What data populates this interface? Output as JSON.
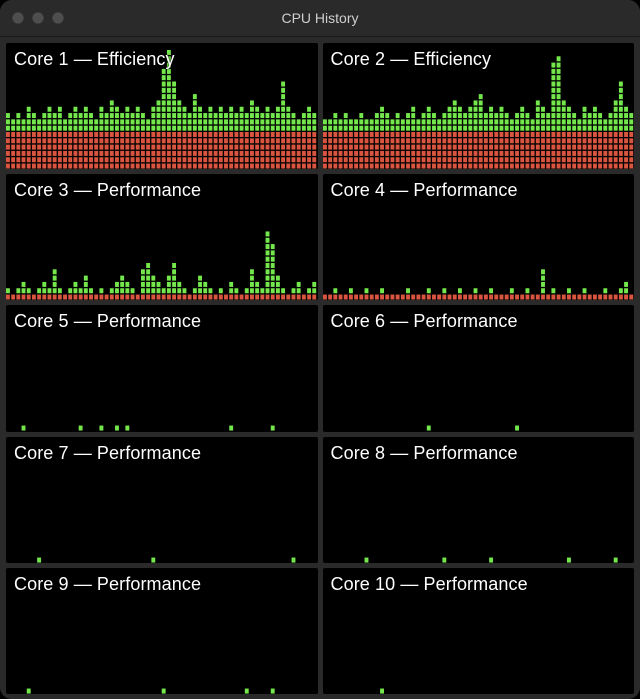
{
  "window": {
    "title": "CPU History"
  },
  "colors": {
    "user": "#74e74c",
    "system": "#d95540",
    "gap": "#000000",
    "panel_bg": "#000000",
    "chrome_bg": "#2a2a2a"
  },
  "layout": {
    "columns_per_panel": 60,
    "max_rows_per_panel": 20,
    "bar_width": 3.6,
    "bar_gap": 1.2,
    "seg_height": 3.8,
    "seg_gap": 1.0
  },
  "cores": [
    {
      "id": 1,
      "label": "Core 1 — Efficiency",
      "system_usage": [
        6,
        6,
        6,
        6,
        6,
        6,
        6,
        6,
        6,
        6,
        6,
        6,
        6,
        6,
        6,
        6,
        6,
        6,
        6,
        6,
        6,
        6,
        6,
        6,
        6,
        6,
        6,
        6,
        6,
        6,
        6,
        6,
        6,
        6,
        6,
        6,
        6,
        6,
        6,
        6,
        6,
        6,
        6,
        6,
        6,
        6,
        6,
        6,
        6,
        6,
        6,
        6,
        6,
        6,
        6,
        6,
        6,
        6,
        6,
        6
      ],
      "user_usage": [
        3,
        2,
        3,
        2,
        4,
        3,
        2,
        3,
        4,
        3,
        4,
        2,
        3,
        4,
        3,
        4,
        3,
        2,
        4,
        3,
        5,
        4,
        3,
        4,
        3,
        4,
        3,
        2,
        4,
        5,
        10,
        13,
        8,
        5,
        4,
        3,
        6,
        4,
        3,
        4,
        3,
        4,
        3,
        4,
        3,
        4,
        3,
        5,
        4,
        3,
        4,
        3,
        4,
        8,
        4,
        3,
        2,
        3,
        4,
        3
      ]
    },
    {
      "id": 2,
      "label": "Core 2 — Efficiency",
      "system_usage": [
        6,
        6,
        6,
        6,
        6,
        6,
        6,
        6,
        6,
        6,
        6,
        6,
        6,
        6,
        6,
        6,
        6,
        6,
        6,
        6,
        6,
        6,
        6,
        6,
        6,
        6,
        6,
        6,
        6,
        6,
        6,
        6,
        6,
        6,
        6,
        6,
        6,
        6,
        6,
        6,
        6,
        6,
        6,
        6,
        6,
        6,
        6,
        6,
        6,
        6,
        6,
        6,
        6,
        6,
        6,
        6,
        6,
        6,
        6,
        6
      ],
      "user_usage": [
        2,
        2,
        3,
        2,
        3,
        2,
        2,
        3,
        2,
        2,
        3,
        4,
        3,
        2,
        3,
        2,
        3,
        4,
        2,
        3,
        4,
        3,
        2,
        3,
        4,
        5,
        4,
        3,
        4,
        5,
        6,
        3,
        4,
        3,
        4,
        3,
        2,
        3,
        4,
        3,
        2,
        5,
        4,
        3,
        11,
        12,
        5,
        4,
        3,
        2,
        4,
        3,
        4,
        3,
        2,
        3,
        5,
        8,
        4,
        3
      ]
    },
    {
      "id": 3,
      "label": "Core 3 — Performance",
      "system_usage": [
        1,
        1,
        1,
        1,
        1,
        1,
        1,
        1,
        1,
        1,
        1,
        1,
        1,
        1,
        1,
        1,
        1,
        1,
        1,
        1,
        1,
        1,
        1,
        1,
        1,
        1,
        1,
        1,
        1,
        1,
        1,
        1,
        1,
        1,
        1,
        1,
        1,
        1,
        1,
        1,
        1,
        1,
        1,
        1,
        1,
        1,
        1,
        1,
        1,
        1,
        1,
        1,
        1,
        1,
        1,
        1,
        1,
        1,
        1,
        1
      ],
      "user_usage": [
        1,
        0,
        1,
        2,
        1,
        0,
        1,
        2,
        1,
        4,
        1,
        0,
        1,
        2,
        1,
        3,
        1,
        0,
        1,
        0,
        1,
        2,
        3,
        2,
        1,
        0,
        4,
        5,
        3,
        2,
        1,
        3,
        5,
        2,
        1,
        0,
        1,
        3,
        2,
        1,
        0,
        1,
        0,
        2,
        1,
        0,
        1,
        4,
        2,
        1,
        10,
        8,
        3,
        1,
        0,
        1,
        2,
        0,
        1,
        2
      ]
    },
    {
      "id": 4,
      "label": "Core 4 — Performance",
      "system_usage": [
        1,
        1,
        1,
        1,
        1,
        1,
        1,
        1,
        1,
        1,
        1,
        1,
        1,
        1,
        1,
        1,
        1,
        1,
        1,
        1,
        1,
        1,
        1,
        1,
        1,
        1,
        1,
        1,
        1,
        1,
        1,
        1,
        1,
        1,
        1,
        1,
        1,
        1,
        1,
        1,
        1,
        1,
        1,
        1,
        1,
        1,
        1,
        1,
        1,
        1,
        1,
        1,
        1,
        1,
        1,
        1,
        1,
        1,
        1,
        1
      ],
      "user_usage": [
        0,
        0,
        1,
        0,
        0,
        1,
        0,
        0,
        1,
        0,
        0,
        1,
        0,
        0,
        0,
        0,
        1,
        0,
        0,
        0,
        1,
        0,
        0,
        1,
        0,
        0,
        1,
        0,
        0,
        1,
        0,
        0,
        1,
        0,
        0,
        0,
        1,
        0,
        0,
        1,
        0,
        0,
        4,
        0,
        1,
        0,
        0,
        1,
        0,
        0,
        1,
        0,
        0,
        0,
        1,
        0,
        0,
        1,
        2,
        0
      ]
    },
    {
      "id": 5,
      "label": "Core 5 — Performance",
      "system_usage": [
        0,
        0,
        0,
        0,
        0,
        0,
        0,
        0,
        0,
        0,
        0,
        0,
        0,
        0,
        0,
        0,
        0,
        0,
        0,
        0,
        0,
        0,
        0,
        0,
        0,
        0,
        0,
        0,
        0,
        0,
        0,
        0,
        0,
        0,
        0,
        0,
        0,
        0,
        0,
        0,
        0,
        0,
        0,
        0,
        0,
        0,
        0,
        0,
        0,
        0,
        0,
        0,
        0,
        0,
        0,
        0,
        0,
        0,
        0,
        0
      ],
      "user_usage": [
        0,
        0,
        0,
        1,
        0,
        0,
        0,
        0,
        0,
        0,
        0,
        0,
        0,
        0,
        1,
        0,
        0,
        0,
        1,
        0,
        0,
        1,
        0,
        1,
        0,
        0,
        0,
        0,
        0,
        0,
        0,
        0,
        0,
        0,
        0,
        0,
        0,
        0,
        0,
        0,
        0,
        0,
        0,
        1,
        0,
        0,
        0,
        0,
        0,
        0,
        0,
        1,
        0,
        0,
        0,
        0,
        0,
        0,
        0,
        0
      ]
    },
    {
      "id": 6,
      "label": "Core 6 — Performance",
      "system_usage": [
        0,
        0,
        0,
        0,
        0,
        0,
        0,
        0,
        0,
        0,
        0,
        0,
        0,
        0,
        0,
        0,
        0,
        0,
        0,
        0,
        0,
        0,
        0,
        0,
        0,
        0,
        0,
        0,
        0,
        0,
        0,
        0,
        0,
        0,
        0,
        0,
        0,
        0,
        0,
        0,
        0,
        0,
        0,
        0,
        0,
        0,
        0,
        0,
        0,
        0,
        0,
        0,
        0,
        0,
        0,
        0,
        0,
        0,
        0,
        0
      ],
      "user_usage": [
        0,
        0,
        0,
        0,
        0,
        0,
        0,
        0,
        0,
        0,
        0,
        0,
        0,
        0,
        0,
        0,
        0,
        0,
        0,
        0,
        1,
        0,
        0,
        0,
        0,
        0,
        0,
        0,
        0,
        0,
        0,
        0,
        0,
        0,
        0,
        0,
        0,
        1,
        0,
        0,
        0,
        0,
        0,
        0,
        0,
        0,
        0,
        0,
        0,
        0,
        0,
        0,
        0,
        0,
        0,
        0,
        0,
        0,
        0,
        0
      ]
    },
    {
      "id": 7,
      "label": "Core 7 — Performance",
      "system_usage": [
        0,
        0,
        0,
        0,
        0,
        0,
        0,
        0,
        0,
        0,
        0,
        0,
        0,
        0,
        0,
        0,
        0,
        0,
        0,
        0,
        0,
        0,
        0,
        0,
        0,
        0,
        0,
        0,
        0,
        0,
        0,
        0,
        0,
        0,
        0,
        0,
        0,
        0,
        0,
        0,
        0,
        0,
        0,
        0,
        0,
        0,
        0,
        0,
        0,
        0,
        0,
        0,
        0,
        0,
        0,
        0,
        0,
        0,
        0,
        0
      ],
      "user_usage": [
        0,
        0,
        0,
        0,
        0,
        0,
        1,
        0,
        0,
        0,
        0,
        0,
        0,
        0,
        0,
        0,
        0,
        0,
        0,
        0,
        0,
        0,
        0,
        0,
        0,
        0,
        0,
        0,
        1,
        0,
        0,
        0,
        0,
        0,
        0,
        0,
        0,
        0,
        0,
        0,
        0,
        0,
        0,
        0,
        0,
        0,
        0,
        0,
        0,
        0,
        0,
        0,
        0,
        0,
        0,
        1,
        0,
        0,
        0,
        0
      ]
    },
    {
      "id": 8,
      "label": "Core 8 — Performance",
      "system_usage": [
        0,
        0,
        0,
        0,
        0,
        0,
        0,
        0,
        0,
        0,
        0,
        0,
        0,
        0,
        0,
        0,
        0,
        0,
        0,
        0,
        0,
        0,
        0,
        0,
        0,
        0,
        0,
        0,
        0,
        0,
        0,
        0,
        0,
        0,
        0,
        0,
        0,
        0,
        0,
        0,
        0,
        0,
        0,
        0,
        0,
        0,
        0,
        0,
        0,
        0,
        0,
        0,
        0,
        0,
        0,
        0,
        0,
        0,
        0,
        0
      ],
      "user_usage": [
        0,
        0,
        0,
        0,
        0,
        0,
        0,
        0,
        1,
        0,
        0,
        0,
        0,
        0,
        0,
        0,
        0,
        0,
        0,
        0,
        0,
        0,
        0,
        1,
        0,
        0,
        0,
        0,
        0,
        0,
        0,
        0,
        1,
        0,
        0,
        0,
        0,
        0,
        0,
        0,
        0,
        0,
        0,
        0,
        0,
        0,
        0,
        1,
        0,
        0,
        0,
        0,
        0,
        0,
        0,
        0,
        1,
        0,
        0,
        0
      ]
    },
    {
      "id": 9,
      "label": "Core 9 — Performance",
      "system_usage": [
        0,
        0,
        0,
        0,
        0,
        0,
        0,
        0,
        0,
        0,
        0,
        0,
        0,
        0,
        0,
        0,
        0,
        0,
        0,
        0,
        0,
        0,
        0,
        0,
        0,
        0,
        0,
        0,
        0,
        0,
        0,
        0,
        0,
        0,
        0,
        0,
        0,
        0,
        0,
        0,
        0,
        0,
        0,
        0,
        0,
        0,
        0,
        0,
        0,
        0,
        0,
        0,
        0,
        0,
        0,
        0,
        0,
        0,
        0,
        0
      ],
      "user_usage": [
        0,
        0,
        0,
        0,
        1,
        0,
        0,
        0,
        0,
        0,
        0,
        0,
        0,
        0,
        0,
        0,
        0,
        0,
        0,
        0,
        0,
        0,
        0,
        0,
        0,
        0,
        0,
        0,
        0,
        0,
        1,
        0,
        0,
        0,
        0,
        0,
        0,
        0,
        0,
        0,
        0,
        0,
        0,
        0,
        0,
        0,
        1,
        0,
        0,
        0,
        0,
        1,
        0,
        0,
        0,
        0,
        0,
        0,
        0,
        0
      ]
    },
    {
      "id": 10,
      "label": "Core 10 — Performance",
      "system_usage": [
        0,
        0,
        0,
        0,
        0,
        0,
        0,
        0,
        0,
        0,
        0,
        0,
        0,
        0,
        0,
        0,
        0,
        0,
        0,
        0,
        0,
        0,
        0,
        0,
        0,
        0,
        0,
        0,
        0,
        0,
        0,
        0,
        0,
        0,
        0,
        0,
        0,
        0,
        0,
        0,
        0,
        0,
        0,
        0,
        0,
        0,
        0,
        0,
        0,
        0,
        0,
        0,
        0,
        0,
        0,
        0,
        0,
        0,
        0,
        0
      ],
      "user_usage": [
        0,
        0,
        0,
        0,
        0,
        0,
        0,
        0,
        0,
        0,
        0,
        1,
        0,
        0,
        0,
        0,
        0,
        0,
        0,
        0,
        0,
        0,
        0,
        0,
        0,
        0,
        0,
        0,
        0,
        0,
        0,
        0,
        0,
        0,
        0,
        0,
        0,
        0,
        0,
        0,
        0,
        0,
        0,
        0,
        0,
        0,
        0,
        0,
        0,
        0,
        0,
        0,
        0,
        0,
        0,
        0,
        0,
        0,
        0,
        0
      ]
    }
  ],
  "chart_data": {
    "type": "bar",
    "note": "Each core panel is a stacked-segment bar history. Units are segment counts out of 20 rows ≈ 100% CPU.",
    "max_segments": 20,
    "series_per_core": [
      "system_usage",
      "user_usage"
    ],
    "colors": {
      "system_usage": "#d95540",
      "user_usage": "#74e74c"
    }
  }
}
